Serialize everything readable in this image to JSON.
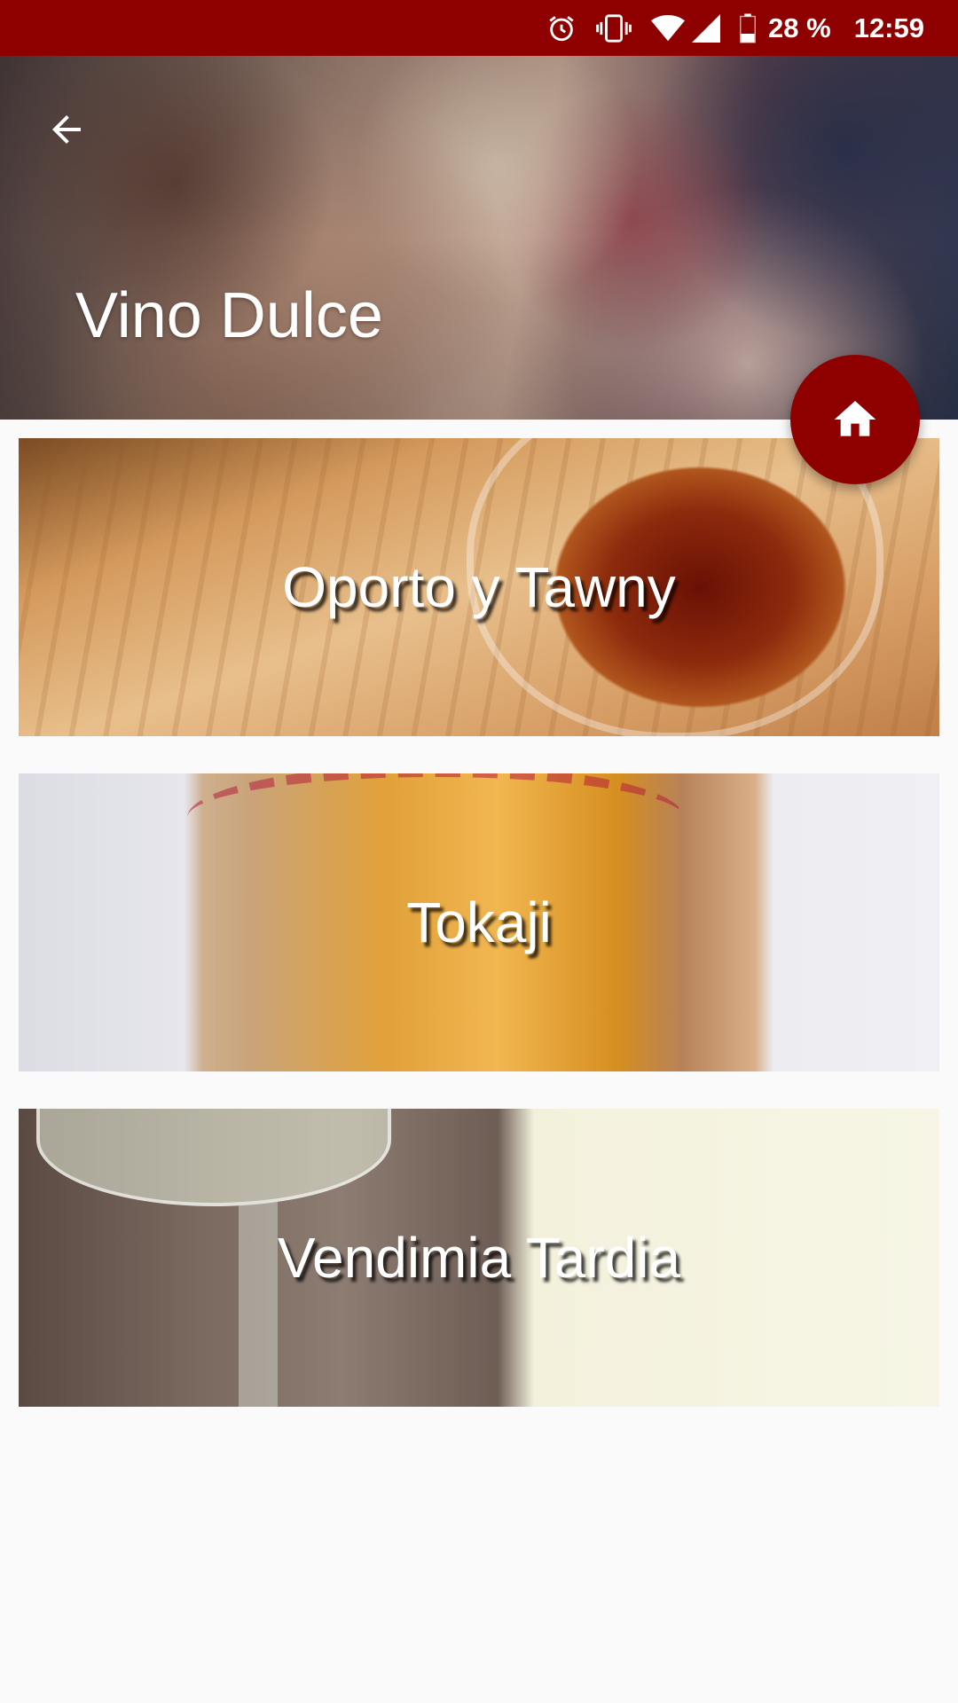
{
  "status_bar": {
    "battery": "28 %",
    "time": "12:59",
    "icons": [
      "alarm-icon",
      "vibrate-icon",
      "wifi-icon",
      "signal-icon",
      "battery-icon"
    ]
  },
  "header": {
    "title": "Vino Dulce",
    "back_icon": "arrow-back-icon"
  },
  "fab": {
    "icon": "home-icon"
  },
  "categories": [
    {
      "label": "Oporto y Tawny"
    },
    {
      "label": "Tokaji"
    },
    {
      "label": "Vendimia Tardia"
    }
  ],
  "colors": {
    "primary": "#8e0000",
    "background": "#fafafa"
  }
}
